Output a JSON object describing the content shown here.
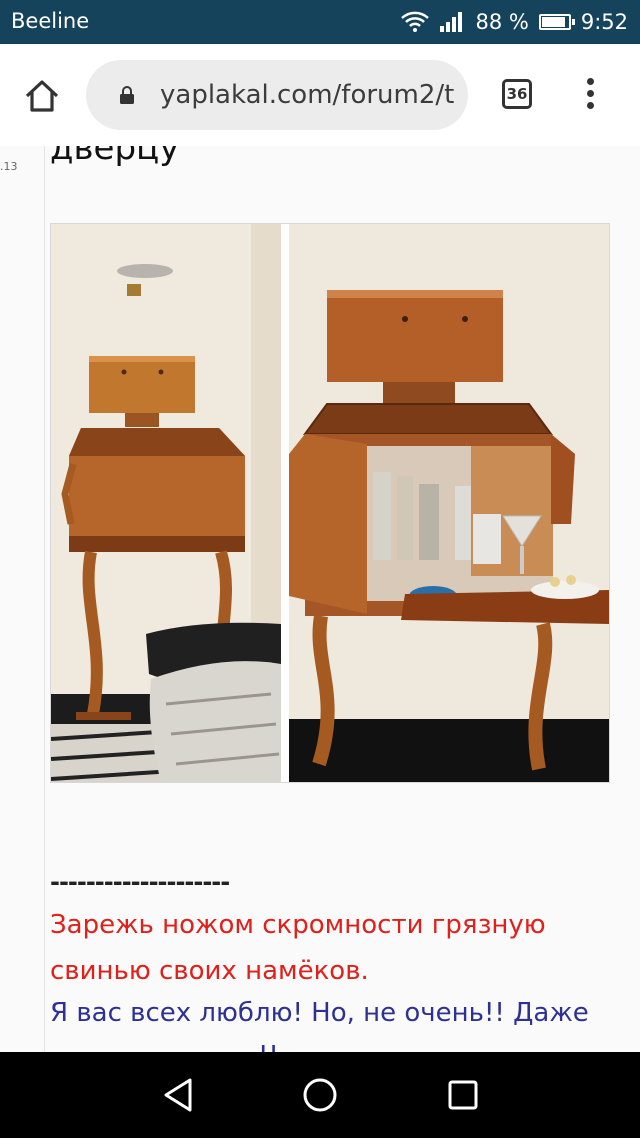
{
  "status_bar": {
    "carrier": "Beeline",
    "battery_text": "88 %",
    "battery_level": 0.88,
    "time": "9:52"
  },
  "browser": {
    "url": "yaplakal.com/forum2/t",
    "tab_count": "36"
  },
  "post": {
    "date_fragment": ".13",
    "heading_fragment": "дверцу",
    "divider": "--------------------",
    "signature_line1": "Зарежь ножом скромности грязную",
    "signature_line2": "свинью своих намёков.",
    "signature_line3": "Я вас всех люблю! Но, не очень!! Даже",
    "signature_line4_partial": "!!"
  },
  "colors": {
    "status_bar": "#15435c",
    "signature_red": "#e0201b",
    "signature_blue": "#2e3192",
    "wood": "#b5652a"
  },
  "icons": [
    "wifi-icon",
    "signal-icon",
    "battery-icon",
    "home-icon",
    "lock-icon",
    "tab-switcher-icon",
    "overflow-menu-icon",
    "back-icon",
    "home-circle-icon",
    "recent-apps-icon"
  ]
}
